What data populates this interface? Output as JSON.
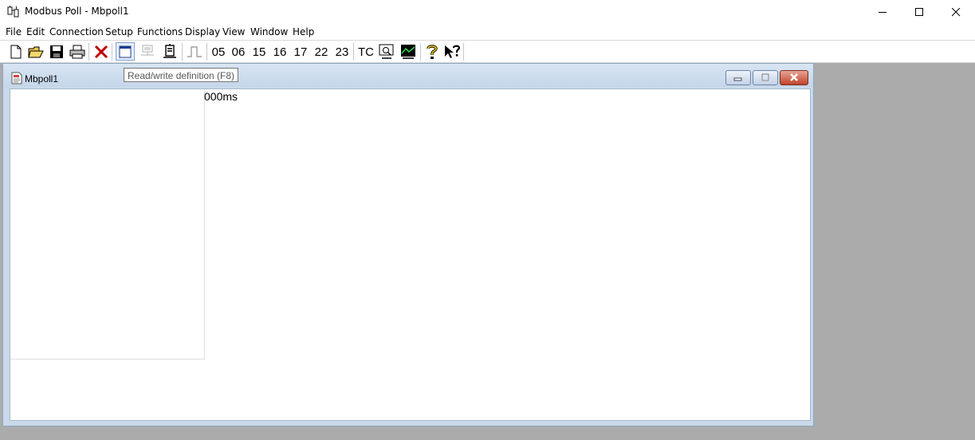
{
  "window": {
    "title": "Modbus Poll - Mbpoll1"
  },
  "menu": [
    "File",
    "Edit",
    "Connection",
    "Setup",
    "Functions",
    "Display",
    "View",
    "Window",
    "Help"
  ],
  "toolbar": {
    "function_codes": [
      "05",
      "06",
      "15",
      "16",
      "17",
      "22",
      "23"
    ],
    "tc_label": "TC",
    "tooltip": "Read/write definition (F8)"
  },
  "child_window": {
    "title": "Mbpoll1",
    "status": "000ms"
  },
  "colors": {
    "desktop": "#ababab",
    "mdi_frame": "#c9d9ea",
    "close_red": "#c0442c"
  }
}
